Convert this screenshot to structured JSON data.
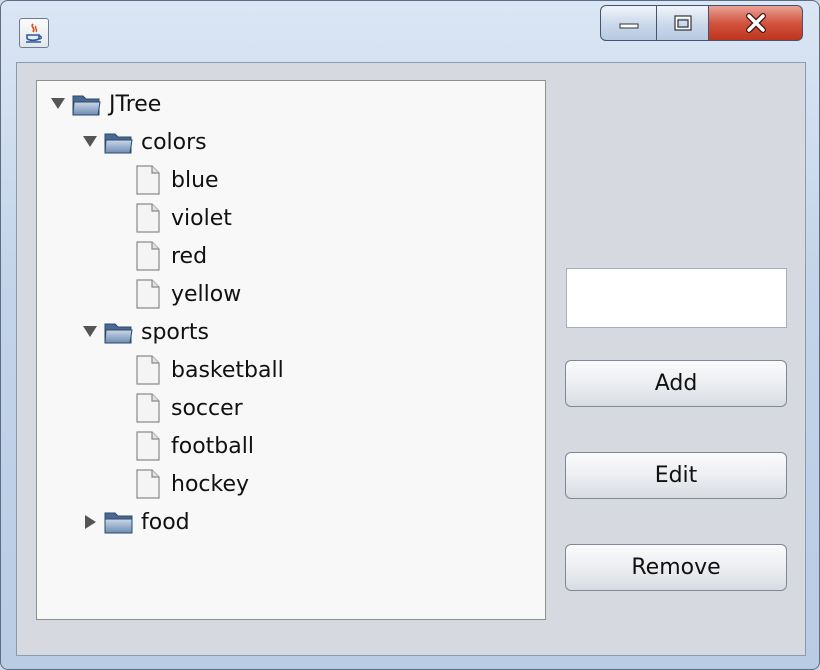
{
  "window": {
    "controls": {
      "minimize": "minimize",
      "maximize": "maximize",
      "close": "close"
    }
  },
  "tree": {
    "root": {
      "label": "JTree",
      "expanded": true
    },
    "groups": [
      {
        "label": "colors",
        "expanded": true,
        "children": [
          "blue",
          "violet",
          "red",
          "yellow"
        ]
      },
      {
        "label": "sports",
        "expanded": true,
        "children": [
          "basketball",
          "soccer",
          "football",
          "hockey"
        ]
      },
      {
        "label": "food",
        "expanded": false,
        "children": []
      }
    ]
  },
  "form": {
    "input_value": "",
    "add_label": "Add",
    "edit_label": "Edit",
    "remove_label": "Remove"
  },
  "colors": {
    "titlebar": "#c4d5ea",
    "close_button": "#c8442c",
    "panel_bg": "#d6d9df",
    "tree_bg": "#f8f8f8"
  }
}
